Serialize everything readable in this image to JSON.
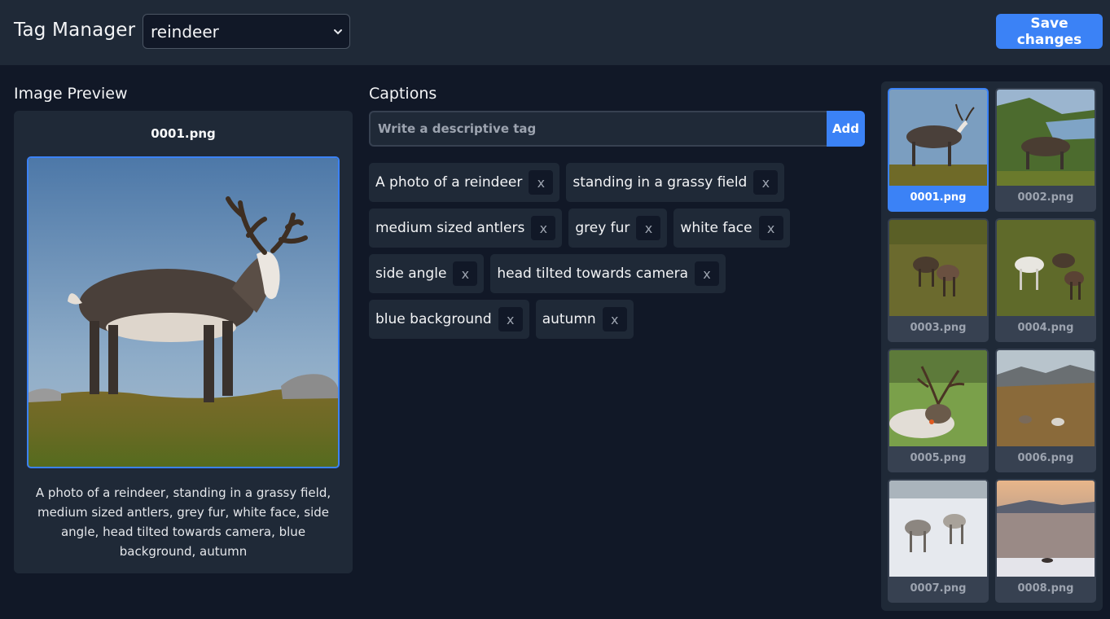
{
  "header": {
    "app_title": "Tag Manager",
    "dataset_selected": "reindeer",
    "save_label": "Save changes"
  },
  "preview": {
    "section_title": "Image Preview",
    "filename": "0001.png",
    "caption": "A photo of a reindeer, standing in a grassy field, medium sized antlers, grey fur, white face, side angle, head tilted towards camera, blue background, autumn"
  },
  "captions": {
    "section_title": "Captions",
    "input_placeholder": "Write a descriptive tag",
    "add_label": "Add",
    "remove_label": "x",
    "tags": [
      "A photo of a reindeer",
      "standing in a grassy field",
      "medium sized antlers",
      "grey fur",
      "white face",
      "side angle",
      "head tilted towards camera",
      "blue background",
      "autumn"
    ]
  },
  "thumbnails": [
    {
      "name": "0001.png",
      "selected": true
    },
    {
      "name": "0002.png",
      "selected": false
    },
    {
      "name": "0003.png",
      "selected": false
    },
    {
      "name": "0004.png",
      "selected": false
    },
    {
      "name": "0005.png",
      "selected": false
    },
    {
      "name": "0006.png",
      "selected": false
    },
    {
      "name": "0007.png",
      "selected": false
    },
    {
      "name": "0008.png",
      "selected": false
    }
  ],
  "colors": {
    "accent": "#3b82f6",
    "background": "#111827",
    "panel": "#1f2937"
  }
}
